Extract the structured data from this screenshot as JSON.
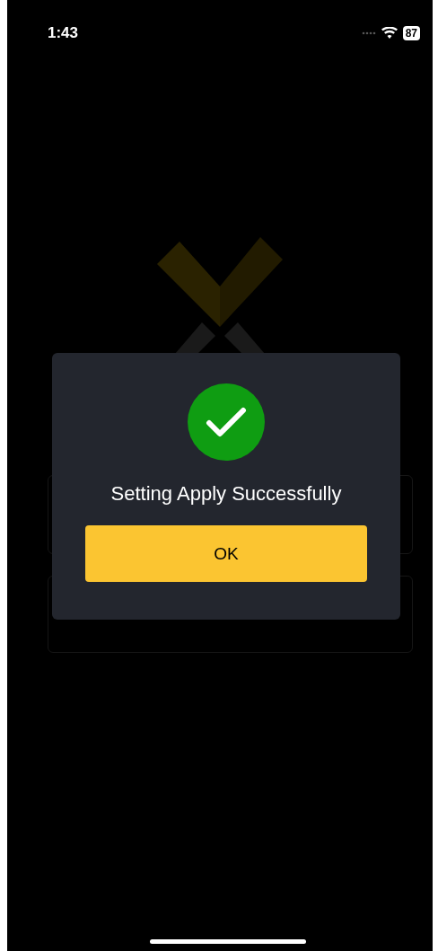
{
  "status_bar": {
    "time": "1:43",
    "battery": "87"
  },
  "dialog": {
    "message": "Setting Apply Successfully",
    "button": "OK"
  }
}
